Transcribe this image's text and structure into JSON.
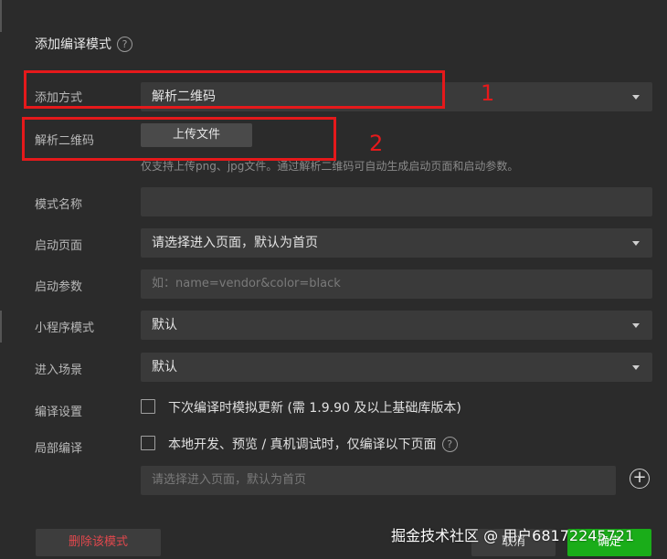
{
  "dialog": {
    "title": "添加编译模式",
    "help_icon": "?"
  },
  "rows": {
    "add_method": {
      "label": "添加方式",
      "value": "解析二维码"
    },
    "parse_qr": {
      "label": "解析二维码",
      "button": "上传文件",
      "hint": "仅支持上传png、jpg文件。通过解析二维码可自动生成启动页面和启动参数。"
    },
    "mode_name": {
      "label": "模式名称",
      "value": ""
    },
    "start_page": {
      "label": "启动页面",
      "value": "请选择进入页面，默认为首页"
    },
    "start_params": {
      "label": "启动参数",
      "placeholder": "如：name=vendor&color=black"
    },
    "miniprogram_mode": {
      "label": "小程序模式",
      "value": "默认"
    },
    "scene": {
      "label": "进入场景",
      "value": "默认"
    },
    "compile_settings": {
      "label": "编译设置",
      "checkbox_label": "下次编译时模拟更新 (需 1.9.90 及以上基础库版本)"
    },
    "partial_compile": {
      "label": "局部编译",
      "checkbox_label": "本地开发、预览 / 真机调试时，仅编译以下页面",
      "page_placeholder": "请选择进入页面，默认为首页"
    }
  },
  "annotations": {
    "box1_number": "1",
    "box2_number": "2",
    "color": "#e5191b"
  },
  "footer": {
    "delete_button": "删除该模式",
    "cancel_button": "取消",
    "ok_button": "确定"
  },
  "watermark": "掘金技术社区 @ 用户68172245721",
  "colors": {
    "background": "#2b2b2b",
    "field": "#3a3a3a",
    "primary": "#1aad19",
    "danger": "#e0484d"
  }
}
